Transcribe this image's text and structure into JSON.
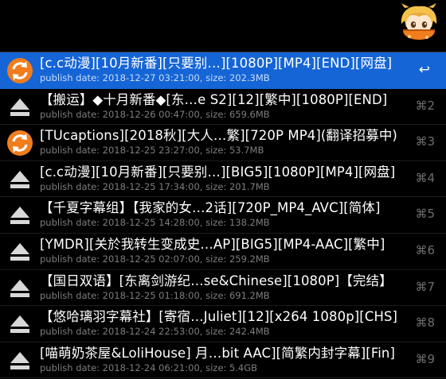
{
  "header": {
    "mascot_icon": "anime-girl-mascot-icon"
  },
  "colors": {
    "selection": "#1565d6",
    "background": "#000000",
    "orange_icon": "#f07d1e",
    "eject_icon": "#d8d8d8"
  },
  "results": [
    {
      "icon": "orange-refresh-icon",
      "title": "[c.c动漫][10月新番][只要别…][1080P][MP4][END][网盘]",
      "meta": "publish date: 2018-12-27 03:21:00, size: 202.3MB",
      "shortcut": "↩"
    },
    {
      "icon": "eject-icon",
      "title": "【搬运】◆十月新番◆[东…e S2][12][繁中][1080P][END]",
      "meta": "publish date: 2018-12-26 00:47:00, size: 659.6MB",
      "shortcut": "⌘2"
    },
    {
      "icon": "orange-refresh-icon",
      "title": "[TUcaptions][2018秋][大人…繁][720P MP4](翻译招募中)",
      "meta": "publish date: 2018-12-25 23:27:00, size: 53.7MB",
      "shortcut": "⌘3"
    },
    {
      "icon": "eject-icon",
      "title": "[c.c动漫][10月新番][只要别…][BIG5][1080P][MP4][网盘]",
      "meta": "publish date: 2018-12-25 17:34:00, size: 201.7MB",
      "shortcut": "⌘4"
    },
    {
      "icon": "eject-icon",
      "title": "【千夏字幕组】【我家的女…2话][720P_MP4_AVC][简体]",
      "meta": "publish date: 2018-12-25 14:28:00, size: 138.2MB",
      "shortcut": "⌘5"
    },
    {
      "icon": "eject-icon",
      "title": "[YMDR][关於我转生变成史…AP][BIG5][MP4-AAC][繁中]",
      "meta": "publish date: 2018-12-25 02:07:00, size: 259.2MB",
      "shortcut": "⌘6"
    },
    {
      "icon": "eject-icon",
      "title": "【国日双语】[东离剑游纪…se&Chinese][1080P]【完结】",
      "meta": "publish date: 2018-12-25 01:18:00, size: 691.2MB",
      "shortcut": "⌘7"
    },
    {
      "icon": "eject-icon",
      "title": "【悠哈璃羽字幕社】[寄宿…Juliet][12][x264 1080p][CHS]",
      "meta": "publish date: 2018-12-24 22:53:00, size: 242.4MB",
      "shortcut": "⌘8"
    },
    {
      "icon": "eject-icon",
      "title": "[喵萌奶茶屋&LoliHouse] 月…bit AAC][简繁内封字幕][Fin]",
      "meta": "publish date: 2018-12-24 06:21:00, size: 5.4GB",
      "shortcut": "⌘9"
    }
  ]
}
